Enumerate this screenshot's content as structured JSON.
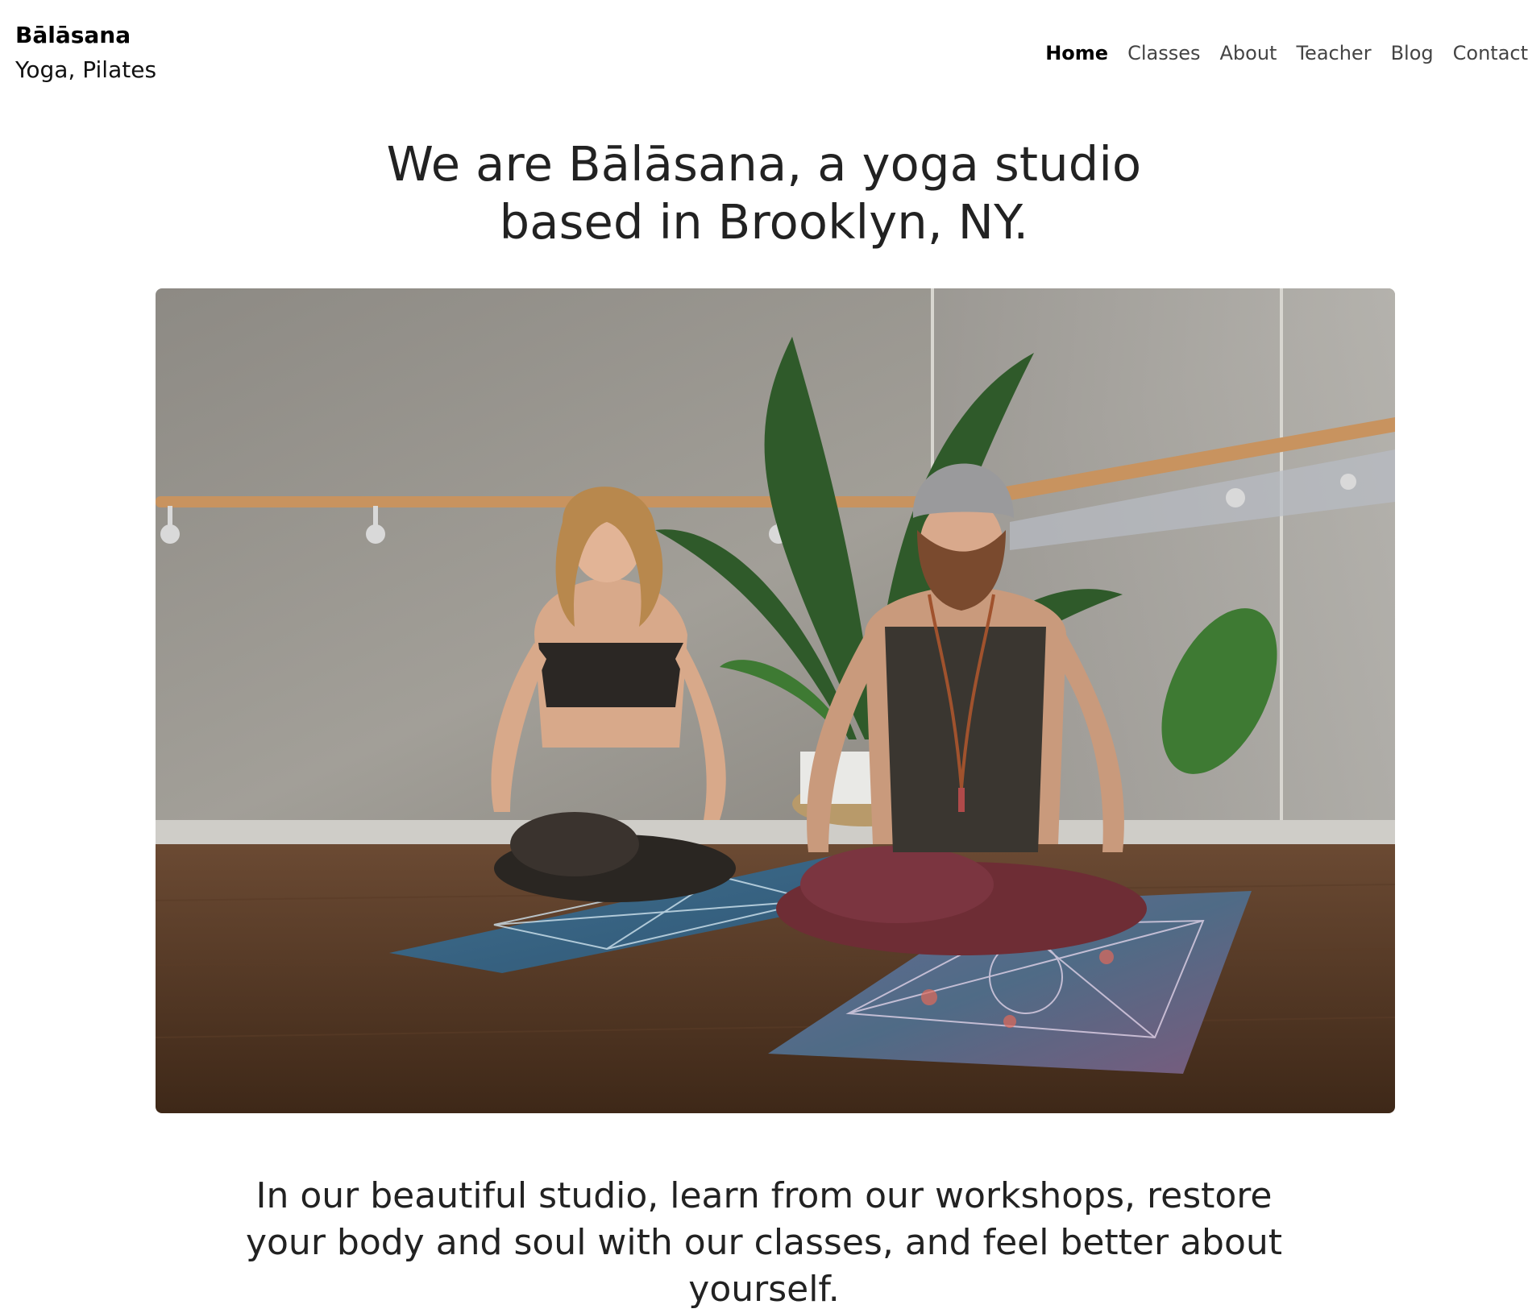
{
  "brand": {
    "name": "Bālāsana",
    "tagline": "Yoga, Pilates"
  },
  "nav": {
    "items": [
      {
        "label": "Home",
        "active": true
      },
      {
        "label": "Classes",
        "active": false
      },
      {
        "label": "About",
        "active": false
      },
      {
        "label": "Teacher",
        "active": false
      },
      {
        "label": "Blog",
        "active": false
      },
      {
        "label": "Contact",
        "active": false
      }
    ]
  },
  "hero": {
    "title": "We are Bālāsana, a yoga studio based in Brooklyn, NY.",
    "image_alt": "Two people meditating in lotus pose on yoga mats in a studio"
  },
  "intro": {
    "text": "In our beautiful studio, learn from our workshops, restore your body and soul with our classes, and feel better about yourself."
  },
  "colors": {
    "text": "#1e1e1e",
    "nav_inactive": "#444444",
    "nav_active": "#000000",
    "background": "#ffffff"
  }
}
